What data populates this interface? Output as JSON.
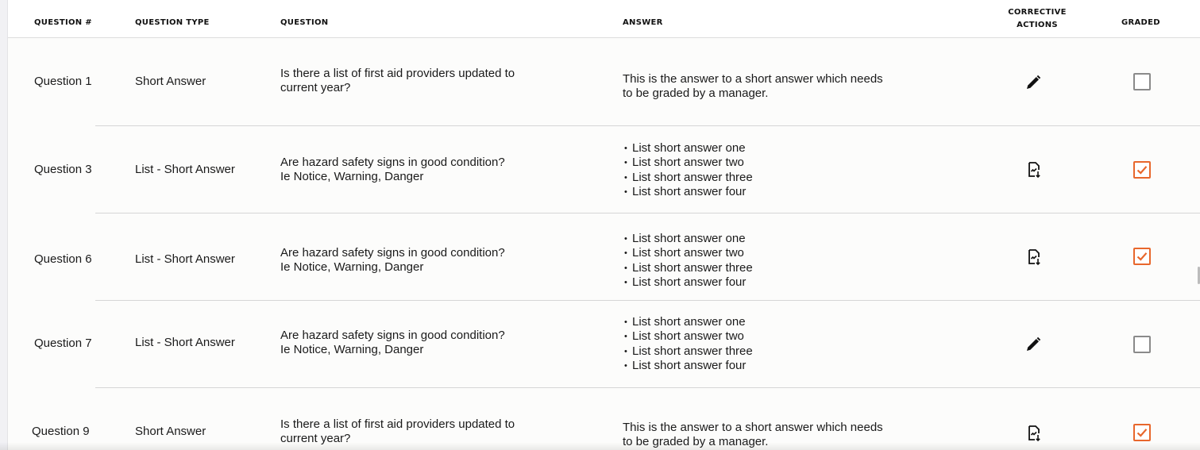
{
  "columns": {
    "question_num": "QUESTION #",
    "question_type": "QUESTION TYPE",
    "question": "QUESTION",
    "answer": "ANSWER",
    "corrective_line1": "CORRECTIVE",
    "corrective_line2": "ACTIONS",
    "graded": "GRADED"
  },
  "rows": [
    {
      "number": "Question 1",
      "type": "Short Answer",
      "question_line1": "Is there a list of first aid providers updated to",
      "question_line2": "current year?",
      "answer_line1": "This is the answer to a short answer which needs",
      "answer_line2": "to be graded by a manager.",
      "corrective_icon": "pencil-icon",
      "graded": false
    },
    {
      "number": "Question 3",
      "type": "List - Short Answer",
      "question_line1": "Are hazard safety signs in good condition?",
      "question_line2": "Ie Notice, Warning, Danger",
      "answer_items": [
        "List short answer one",
        "List short answer two",
        "List short answer three",
        "List short answer four"
      ],
      "corrective_icon": "document-download-icon",
      "graded": true
    },
    {
      "number": "Question 6",
      "type": "List - Short Answer",
      "question_line1": "Are hazard safety signs in good condition?",
      "question_line2": "Ie Notice, Warning, Danger",
      "answer_items": [
        "List short answer one",
        "List short answer two",
        "List short answer three",
        "List short answer four"
      ],
      "corrective_icon": "document-download-icon",
      "graded": true
    },
    {
      "number": "Question 7",
      "type": "List - Short Answer",
      "question_line1": "Are hazard safety signs in good condition?",
      "question_line2": "Ie Notice, Warning, Danger",
      "answer_items": [
        "List short answer one",
        "List short answer two",
        "List short answer three",
        "List short answer four"
      ],
      "corrective_icon": "pencil-icon",
      "graded": false
    },
    {
      "number": "Question 9",
      "type": "Short Answer",
      "question_line1": "Is there a list of first aid providers updated to",
      "question_line2": "current year?",
      "answer_line1": "This is the answer to a short answer which needs",
      "answer_line2": "to be graded by a manager.",
      "corrective_icon": "document-download-icon",
      "graded": true
    }
  ],
  "colors": {
    "accent_checked": "#e8672c",
    "checkbox_unchecked": "#8a8a8a",
    "row_divider": "#d6d6d6"
  }
}
